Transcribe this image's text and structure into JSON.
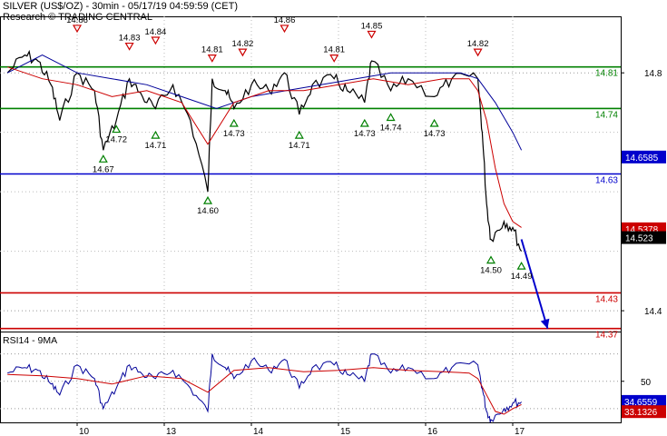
{
  "header": {
    "title": "SILVER (US$/OZ) - 30min - 05/17/19 04:59:59 (CET)",
    "source": "Research © TRADING CENTRAL"
  },
  "colors": {
    "support": "#008000",
    "pivot": "#0000cc",
    "resistance": "#cc0000",
    "price": "#000000",
    "ma_fast": "#cc0000",
    "ma_slow": "#000099",
    "box_red": "#cc0000",
    "box_blue": "#0000cc",
    "box_black": "#000000"
  },
  "chart_data": [
    {
      "type": "line",
      "panel": "price",
      "y_axis": {
        "range": [
          14.365,
          14.895
        ],
        "ticks": [
          14.8,
          14.4
        ]
      },
      "x_axis": {
        "ticks": [
          "10",
          "13",
          "14",
          "15",
          "16",
          "17"
        ]
      },
      "levels": [
        {
          "value": 14.81,
          "label": "14.81",
          "color": "#008000"
        },
        {
          "value": 14.74,
          "label": "14.74",
          "color": "#008000"
        },
        {
          "value": 14.63,
          "label": "14.63",
          "color": "#0000cc"
        },
        {
          "value": 14.43,
          "label": "14.43",
          "color": "#cc0000"
        },
        {
          "value": 14.37,
          "label": "14.37",
          "color": "#cc0000"
        }
      ],
      "value_boxes": [
        {
          "value": 14.6585,
          "label": "14.6585",
          "color": "#0000cc"
        },
        {
          "value": 14.5378,
          "label": "14.5378",
          "color": "#cc0000"
        },
        {
          "value": 14.523,
          "label": "14.523",
          "color": "#000000"
        }
      ],
      "highs": [
        {
          "x": 0.0,
          "value": 14.86,
          "label": "14.86"
        },
        {
          "x": 0.6,
          "value": 14.83,
          "label": "14.83"
        },
        {
          "x": 0.9,
          "value": 14.84,
          "label": "14.84"
        },
        {
          "x": 1.55,
          "value": 14.81,
          "label": "14.81"
        },
        {
          "x": 1.9,
          "value": 14.82,
          "label": "14.82"
        },
        {
          "x": 2.38,
          "value": 14.86,
          "label": "14.86"
        },
        {
          "x": 2.95,
          "value": 14.81,
          "label": "14.81"
        },
        {
          "x": 3.38,
          "value": 14.85,
          "label": "14.85"
        },
        {
          "x": 4.6,
          "value": 14.82,
          "label": "14.82"
        }
      ],
      "lows": [
        {
          "x": 0.3,
          "value": 14.67,
          "label": "14.67"
        },
        {
          "x": 0.45,
          "value": 14.72,
          "label": "14.72"
        },
        {
          "x": 0.9,
          "value": 14.71,
          "label": "14.71"
        },
        {
          "x": 1.5,
          "value": 14.6,
          "label": "14.60"
        },
        {
          "x": 1.8,
          "value": 14.73,
          "label": "14.73"
        },
        {
          "x": 2.55,
          "value": 14.71,
          "label": "14.71"
        },
        {
          "x": 3.3,
          "value": 14.73,
          "label": "14.73"
        },
        {
          "x": 3.6,
          "value": 14.74,
          "label": "14.74"
        },
        {
          "x": 4.1,
          "value": 14.73,
          "label": "14.73"
        },
        {
          "x": 4.75,
          "value": 14.5,
          "label": "14.50"
        },
        {
          "x": 5.1,
          "value": 14.49,
          "label": "14.49"
        }
      ],
      "forecast": {
        "from": [
          5.1,
          14.52
        ],
        "to": [
          5.4,
          14.37
        ]
      },
      "price_series": {
        "x": [
          -0.8,
          -0.6,
          -0.45,
          -0.3,
          -0.2,
          0.0,
          0.2,
          0.3,
          0.45,
          0.6,
          0.75,
          0.9,
          1.1,
          1.3,
          1.5,
          1.55,
          1.7,
          1.8,
          2.0,
          2.2,
          2.38,
          2.55,
          2.7,
          2.95,
          3.1,
          3.3,
          3.38,
          3.6,
          3.8,
          4.1,
          4.3,
          4.6,
          4.65,
          4.7,
          4.75,
          4.9,
          5.0,
          5.1
        ],
        "y": [
          14.8,
          14.83,
          14.82,
          14.78,
          14.72,
          14.8,
          14.77,
          14.67,
          14.72,
          14.79,
          14.76,
          14.74,
          14.78,
          14.72,
          14.6,
          14.79,
          14.77,
          14.74,
          14.78,
          14.77,
          14.8,
          14.73,
          14.78,
          14.79,
          14.77,
          14.75,
          14.82,
          14.77,
          14.79,
          14.76,
          14.79,
          14.79,
          14.7,
          14.58,
          14.52,
          14.55,
          14.54,
          14.5
        ]
      },
      "ma_fast": {
        "x": [
          -0.8,
          -0.4,
          0.0,
          0.4,
          0.8,
          1.2,
          1.5,
          1.8,
          2.2,
          2.6,
          3.0,
          3.4,
          3.8,
          4.2,
          4.5,
          4.6,
          4.7,
          4.8,
          4.9,
          5.0,
          5.1
        ],
        "y": [
          14.81,
          14.79,
          14.78,
          14.76,
          14.77,
          14.75,
          14.68,
          14.75,
          14.77,
          14.77,
          14.78,
          14.79,
          14.78,
          14.79,
          14.79,
          14.77,
          14.72,
          14.64,
          14.58,
          14.55,
          14.54
        ]
      },
      "ma_slow": {
        "x": [
          -0.8,
          -0.4,
          0.0,
          0.4,
          0.8,
          1.2,
          1.6,
          2.0,
          2.4,
          2.8,
          3.2,
          3.6,
          4.0,
          4.4,
          4.6,
          4.8,
          5.0,
          5.1
        ],
        "y": [
          14.8,
          14.83,
          14.8,
          14.79,
          14.78,
          14.76,
          14.74,
          14.76,
          14.77,
          14.78,
          14.79,
          14.8,
          14.8,
          14.8,
          14.79,
          14.75,
          14.7,
          14.67
        ]
      }
    },
    {
      "type": "line",
      "panel": "rsi",
      "title": "RSI14 - 9MA",
      "y_axis": {
        "range": [
          20,
          85
        ],
        "ticks": [
          50
        ]
      },
      "value_boxes": [
        {
          "value": 34.6559,
          "label": "34.6559",
          "color": "#0000cc"
        },
        {
          "value": 33.1326,
          "label": "33.1326",
          "color": "#cc0000"
        }
      ],
      "series": [
        {
          "name": "RSI14",
          "x": [
            -0.8,
            -0.6,
            -0.45,
            -0.3,
            -0.2,
            0.0,
            0.2,
            0.3,
            0.45,
            0.6,
            0.75,
            0.9,
            1.1,
            1.3,
            1.5,
            1.55,
            1.7,
            1.8,
            2.0,
            2.2,
            2.38,
            2.55,
            2.7,
            2.95,
            3.1,
            3.3,
            3.38,
            3.6,
            3.8,
            4.1,
            4.3,
            4.6,
            4.65,
            4.7,
            4.75,
            4.9,
            5.0,
            5.1
          ],
          "y": [
            56,
            60,
            58,
            48,
            40,
            62,
            52,
            30,
            45,
            62,
            55,
            52,
            58,
            45,
            28,
            70,
            60,
            52,
            65,
            58,
            66,
            45,
            60,
            62,
            55,
            50,
            70,
            56,
            60,
            52,
            60,
            62,
            45,
            28,
            22,
            30,
            34,
            35
          ]
        },
        {
          "name": "9MA",
          "x": [
            -0.8,
            -0.4,
            0.0,
            0.4,
            0.8,
            1.2,
            1.5,
            1.8,
            2.2,
            2.6,
            3.0,
            3.4,
            3.8,
            4.2,
            4.5,
            4.6,
            4.7,
            4.8,
            4.9,
            5.0,
            5.1
          ],
          "y": [
            55,
            54,
            52,
            48,
            54,
            52,
            42,
            58,
            60,
            57,
            58,
            60,
            58,
            57,
            56,
            52,
            40,
            28,
            26,
            30,
            33
          ]
        }
      ]
    }
  ]
}
